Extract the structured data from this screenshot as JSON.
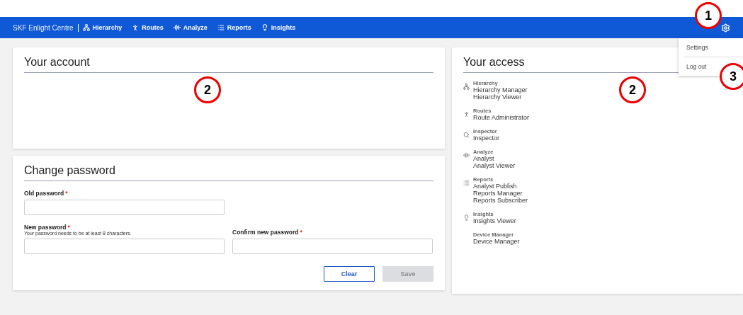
{
  "navbar": {
    "brand": "SKF Enlight Centre",
    "items": [
      {
        "label": "Hierarchy"
      },
      {
        "label": "Routes"
      },
      {
        "label": "Analyze"
      },
      {
        "label": "Reports"
      },
      {
        "label": "Insights"
      }
    ]
  },
  "settings_menu": {
    "expanded": true,
    "items": [
      {
        "label": "Settings"
      },
      {
        "label": "Log out"
      }
    ]
  },
  "account": {
    "title": "Your account"
  },
  "change_password": {
    "title": "Change password",
    "fields": [
      {
        "label": "Old password",
        "required_mark": "*"
      },
      {
        "label": "New password",
        "required_mark": "*",
        "hint": "Your password needs to be at least 8 characters."
      },
      {
        "label": "Confirm new password",
        "required_mark": "*"
      }
    ],
    "buttons": [
      {
        "label": "Clear",
        "disabled": false
      },
      {
        "label": "Save",
        "disabled": true
      }
    ]
  },
  "access": {
    "title": "Your access",
    "groups": [
      {
        "name": "Hierarchy",
        "roles": [
          "Hierarchy Manager",
          "Hierarchy Viewer"
        ]
      },
      {
        "name": "Routes",
        "roles": [
          "Route Administrator"
        ]
      },
      {
        "name": "Inspector",
        "roles": [
          "Inspector"
        ]
      },
      {
        "name": "Analyze",
        "roles": [
          "Analyst",
          "Analyst Viewer"
        ]
      },
      {
        "name": "Reports",
        "roles": [
          "Analyst Publish",
          "Reports Manager",
          "Reports Subscriber"
        ]
      },
      {
        "name": "Insights",
        "roles": [
          "Insights Viewer"
        ]
      },
      {
        "name": "Device Manager",
        "roles": [
          "Device Manager"
        ]
      }
    ]
  },
  "callouts": [
    {
      "number": "1"
    },
    {
      "number": "2"
    },
    {
      "number": "2"
    },
    {
      "number": "3"
    }
  ]
}
